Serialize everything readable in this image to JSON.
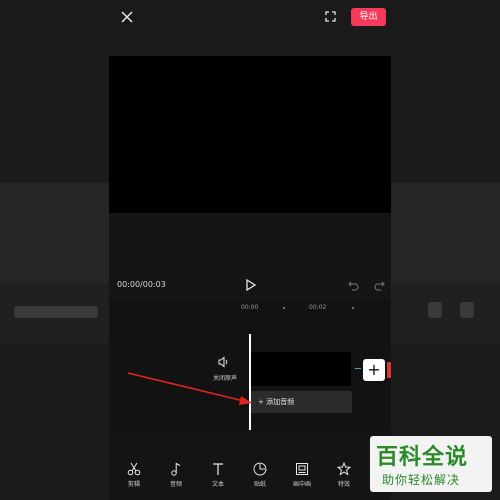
{
  "header": {
    "export_label": "导出"
  },
  "player": {
    "time": "00:00/00:03"
  },
  "timeline": {
    "ruler": [
      "00:00",
      "00:02"
    ],
    "mute_label": "关闭原声",
    "add_audio_label": "+ 添加音频"
  },
  "toolbar": {
    "items": [
      {
        "label": "剪辑",
        "icon": "scissors-icon"
      },
      {
        "label": "音频",
        "icon": "music-note-icon"
      },
      {
        "label": "文本",
        "icon": "text-icon"
      },
      {
        "label": "贴纸",
        "icon": "sticker-icon"
      },
      {
        "label": "画中画",
        "icon": "picture-in-picture-icon"
      },
      {
        "label": "特效",
        "icon": "effects-star-icon"
      }
    ]
  },
  "watermark": {
    "title": "百科全说",
    "subtitle": "助你轻松解决"
  },
  "colors": {
    "accent": "#f5395a",
    "annotation_arrow": "#e0241e",
    "watermark_green": "#2a8a2a"
  }
}
